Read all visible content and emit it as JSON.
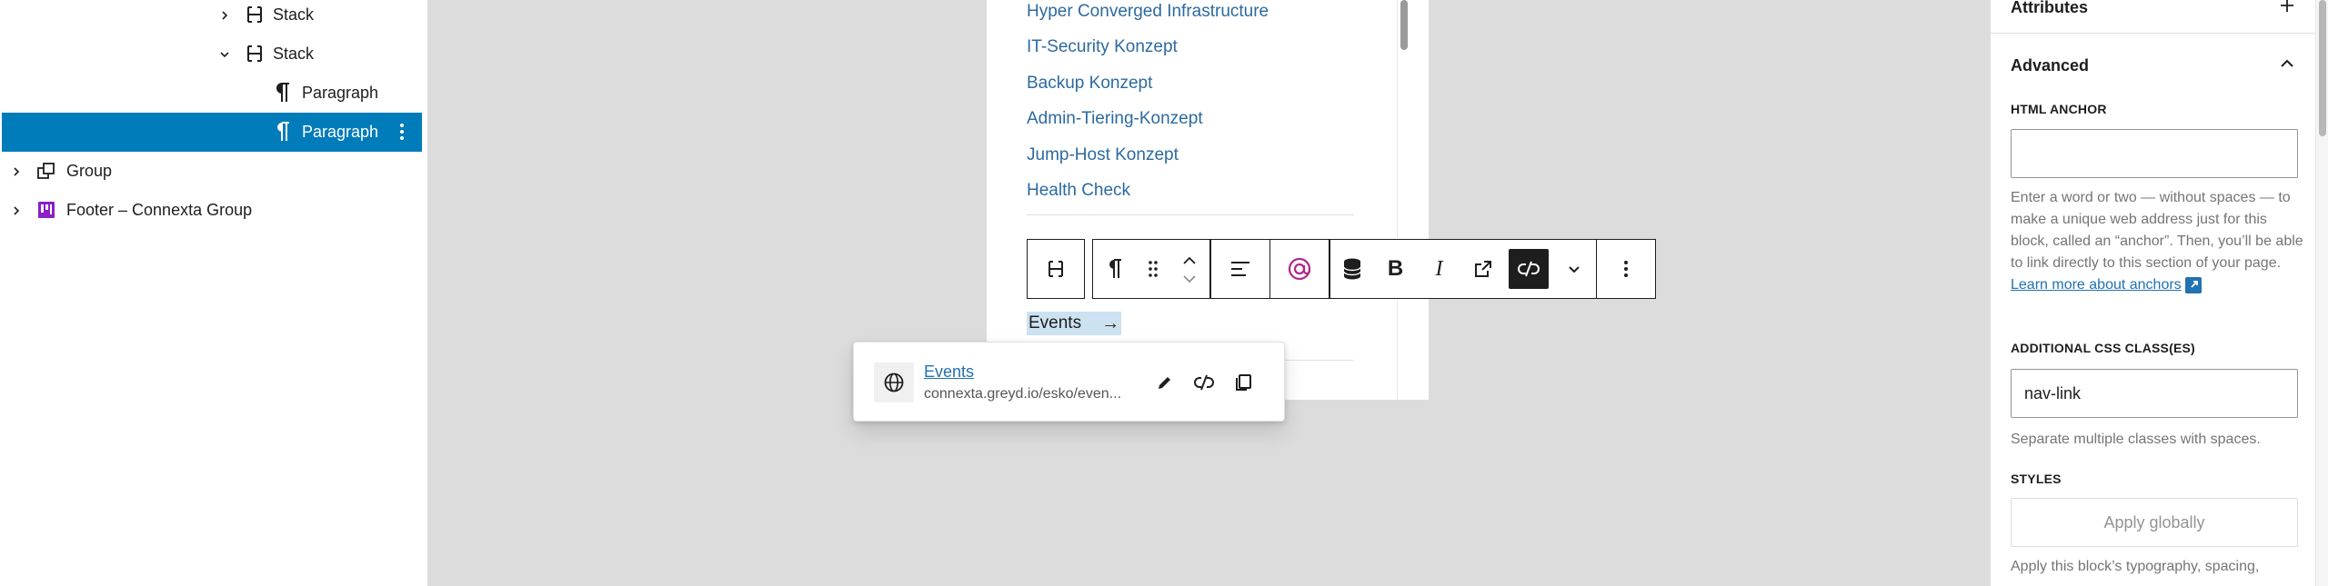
{
  "listview": {
    "items": [
      {
        "label": "Stack",
        "icon": "stack-icon",
        "chevron": "chevron-right-icon"
      },
      {
        "label": "Stack",
        "icon": "stack-icon",
        "chevron": "chevron-down-icon"
      },
      {
        "label": "Paragraph",
        "icon": "paragraph-icon"
      },
      {
        "label": "Paragraph",
        "icon": "paragraph-icon",
        "selected": true
      },
      {
        "label": "Group",
        "icon": "group-icon",
        "chevron": "chevron-right-icon"
      },
      {
        "label": "Footer – Connexta Group",
        "icon": "template-part-icon",
        "chevron": "chevron-right-icon"
      }
    ],
    "selected_color": "#007cba"
  },
  "canvas": {
    "links": [
      "Hyper Converged Infrastructure",
      "IT-Security Konzept",
      "Backup Konzept",
      "Admin-Tiering-Konzept",
      "Jump-Host Konzept",
      "Health Check"
    ],
    "current_link_text": "Events",
    "current_link_arrow": "→",
    "link_color": "#2c6aa0",
    "highlight_color": "#cde2f1"
  },
  "toolbar": {
    "buttons": [
      "stack-icon",
      "paragraph-icon",
      "drag-handle-icon",
      "move-up-down-icon",
      "align-left-icon",
      "at-symbol-icon",
      "database-icon",
      "bold-icon",
      "italic-icon",
      "external-link-icon",
      "unlink-icon",
      "chevron-down-icon",
      "more-options-icon"
    ],
    "bold_label": "B",
    "italic_label": "I"
  },
  "link_popover": {
    "title": "Events",
    "url": "connexta.greyd.io/esko/even..."
  },
  "sidebar": {
    "attributes_label": "Attributes",
    "advanced_label": "Advanced",
    "html_anchor_label": "HTML ANCHOR",
    "html_anchor_value": "",
    "html_anchor_help": "Enter a word or two — without spaces — to make a unique web address just for this block, called an “anchor”. Then, you’ll be able to link directly to this section of your page.",
    "learn_more_link": "Learn more about anchors",
    "css_class_label": "ADDITIONAL CSS CLASS(ES)",
    "css_class_value": "nav-link",
    "css_class_help": "Separate multiple classes with spaces.",
    "styles_label": "STYLES",
    "apply_globally_label": "Apply globally",
    "bottom_help": "Apply this block’s typography, spacing,"
  }
}
